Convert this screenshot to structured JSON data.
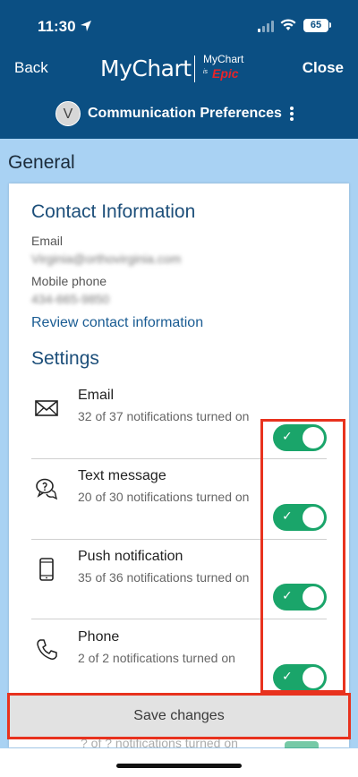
{
  "status_bar": {
    "time": "11:30",
    "battery": "65"
  },
  "nav": {
    "back_label": "Back",
    "close_label": "Close",
    "logo_main": "MyChart",
    "logo_small": "MyChart",
    "logo_is": "is",
    "logo_epic": "Epic"
  },
  "subbar": {
    "avatar_initial": "V",
    "title": "Communication Preferences"
  },
  "section": {
    "title": "General"
  },
  "contact": {
    "heading": "Contact Information",
    "email_label": "Email",
    "email_value": "Virginia@orthovirginia.com",
    "phone_label": "Mobile phone",
    "phone_value": "434-665-9850",
    "review_link": "Review contact information"
  },
  "settings": {
    "heading": "Settings",
    "items": [
      {
        "title": "Email",
        "subtitle": "32 of 37 notifications turned on",
        "icon": "envelope-icon",
        "enabled": true
      },
      {
        "title": "Text message",
        "subtitle": "20 of 30 notifications turned on",
        "icon": "chat-bubbles-icon",
        "enabled": true
      },
      {
        "title": "Push notification",
        "subtitle": "35 of 36 notifications turned on",
        "icon": "mobile-phone-icon",
        "enabled": true
      },
      {
        "title": "Phone",
        "subtitle": "2 of 2 notifications turned on",
        "icon": "phone-handset-icon",
        "enabled": true
      }
    ],
    "partial_next_subtitle": "? of ? notifications turned on"
  },
  "footer": {
    "save_label": "Save changes"
  },
  "colors": {
    "header_bg": "#0b4f83",
    "section_band": "#a9d2f3",
    "toggle_on": "#1aa56a",
    "highlight": "#e8321e",
    "link": "#1a5c93"
  }
}
